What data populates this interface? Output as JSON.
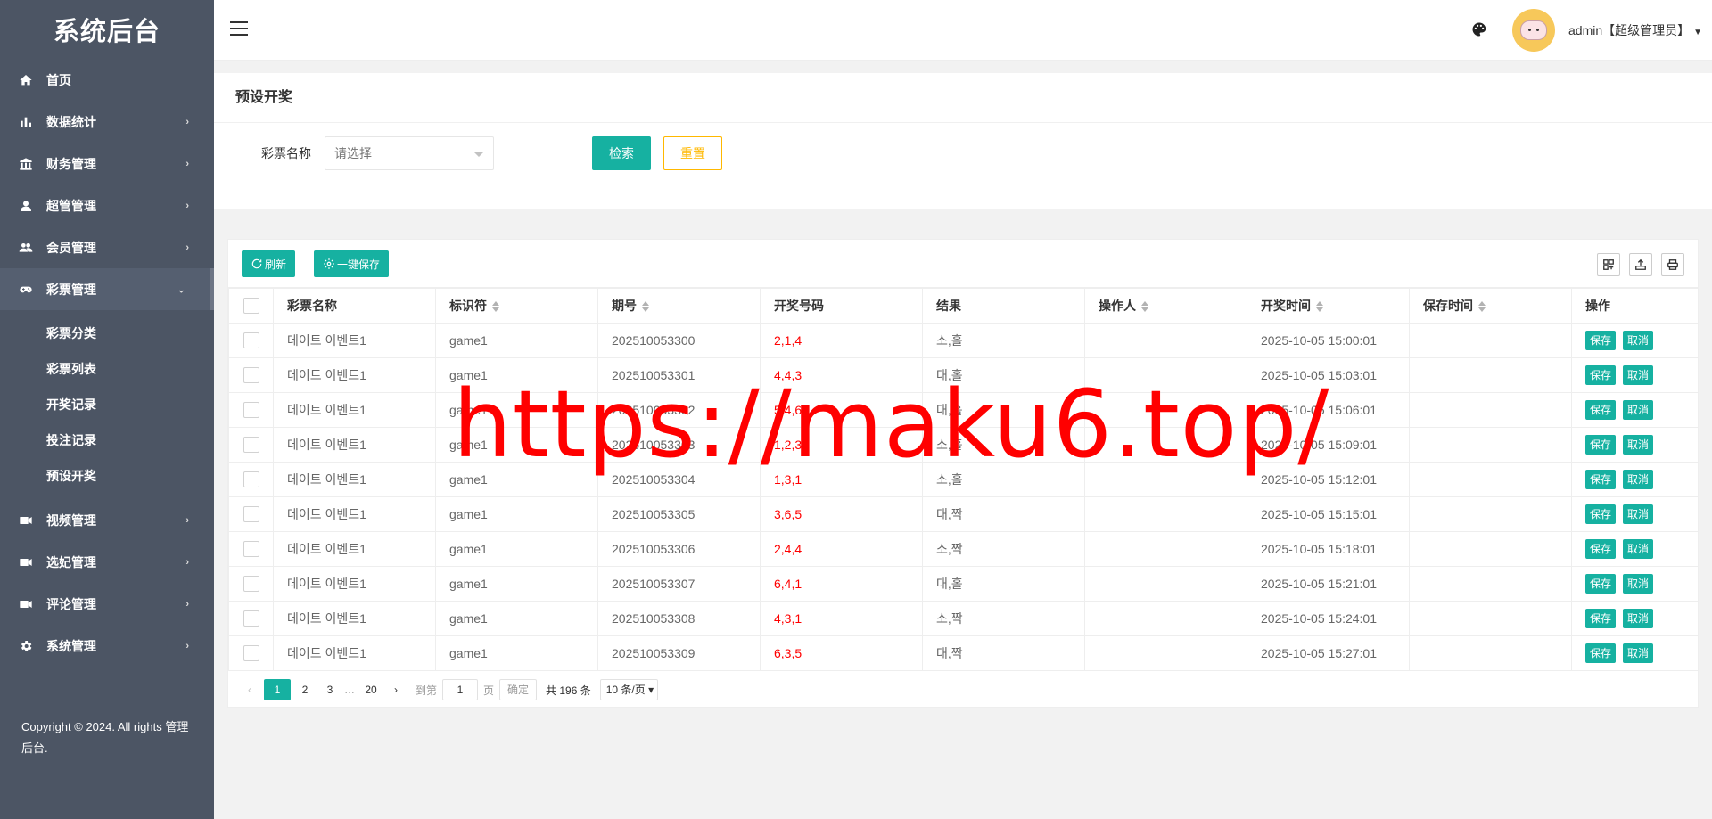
{
  "app": {
    "title": "系统后台"
  },
  "sidebar": {
    "items": [
      {
        "label": "首页",
        "icon": "home-icon",
        "has_children": false
      },
      {
        "label": "数据统计",
        "icon": "bar-chart-icon",
        "has_children": true
      },
      {
        "label": "财务管理",
        "icon": "bank-icon",
        "has_children": true
      },
      {
        "label": "超管管理",
        "icon": "user-icon",
        "has_children": true
      },
      {
        "label": "会员管理",
        "icon": "users-icon",
        "has_children": true
      },
      {
        "label": "彩票管理",
        "icon": "gamepad-icon",
        "has_children": true,
        "expanded": true,
        "children": [
          "彩票分类",
          "彩票列表",
          "开奖记录",
          "投注记录",
          "预设开奖"
        ]
      },
      {
        "label": "视频管理",
        "icon": "video-icon",
        "has_children": true
      },
      {
        "label": "选妃管理",
        "icon": "video-icon",
        "has_children": true
      },
      {
        "label": "评论管理",
        "icon": "video-icon",
        "has_children": true
      },
      {
        "label": "系统管理",
        "icon": "gear-icon",
        "has_children": true
      }
    ],
    "copyright": "Copyright © 2024. All rights 管理后台."
  },
  "header": {
    "user": "admin【超级管理员】"
  },
  "search": {
    "title": "预设开奖",
    "label": "彩票名称",
    "placeholder": "请选择",
    "search_btn": "检索",
    "reset_btn": "重置"
  },
  "toolbar": {
    "refresh": "刷新",
    "save_all": "一键保存"
  },
  "table": {
    "columns": [
      "彩票名称",
      "标识符",
      "期号",
      "开奖号码",
      "结果",
      "操作人",
      "开奖时间",
      "保存时间",
      "操作"
    ],
    "actions": {
      "save": "保存",
      "cancel": "取消"
    },
    "rows": [
      {
        "name": "데이트 이벤트1",
        "code": "game1",
        "issue": "202510053300",
        "numbers": "2,1,4",
        "result": "소,홀",
        "operator": "",
        "open_time": "2025-10-05 15:00:01",
        "save_time": ""
      },
      {
        "name": "데이트 이벤트1",
        "code": "game1",
        "issue": "202510053301",
        "numbers": "4,4,3",
        "result": "대,홀",
        "operator": "",
        "open_time": "2025-10-05 15:03:01",
        "save_time": ""
      },
      {
        "name": "데이트 이벤트1",
        "code": "game1",
        "issue": "202510053302",
        "numbers": "5,4,6",
        "result": "대,홀",
        "operator": "",
        "open_time": "2025-10-05 15:06:01",
        "save_time": ""
      },
      {
        "name": "데이트 이벤트1",
        "code": "game1",
        "issue": "202510053303",
        "numbers": "1,2,3",
        "result": "소,홀",
        "operator": "",
        "open_time": "2025-10-05 15:09:01",
        "save_time": ""
      },
      {
        "name": "데이트 이벤트1",
        "code": "game1",
        "issue": "202510053304",
        "numbers": "1,3,1",
        "result": "소,홀",
        "operator": "",
        "open_time": "2025-10-05 15:12:01",
        "save_time": ""
      },
      {
        "name": "데이트 이벤트1",
        "code": "game1",
        "issue": "202510053305",
        "numbers": "3,6,5",
        "result": "대,짝",
        "operator": "",
        "open_time": "2025-10-05 15:15:01",
        "save_time": ""
      },
      {
        "name": "데이트 이벤트1",
        "code": "game1",
        "issue": "202510053306",
        "numbers": "2,4,4",
        "result": "소,짝",
        "operator": "",
        "open_time": "2025-10-05 15:18:01",
        "save_time": ""
      },
      {
        "name": "데이트 이벤트1",
        "code": "game1",
        "issue": "202510053307",
        "numbers": "6,4,1",
        "result": "대,홀",
        "operator": "",
        "open_time": "2025-10-05 15:21:01",
        "save_time": ""
      },
      {
        "name": "데이트 이벤트1",
        "code": "game1",
        "issue": "202510053308",
        "numbers": "4,3,1",
        "result": "소,짝",
        "operator": "",
        "open_time": "2025-10-05 15:24:01",
        "save_time": ""
      },
      {
        "name": "데이트 이벤트1",
        "code": "game1",
        "issue": "202510053309",
        "numbers": "6,3,5",
        "result": "대,짝",
        "operator": "",
        "open_time": "2025-10-05 15:27:01",
        "save_time": ""
      }
    ]
  },
  "pagination": {
    "pages": [
      "1",
      "2",
      "3"
    ],
    "ellipsis": "…",
    "last": "20",
    "current": "1",
    "goto_label": "到第",
    "goto_value": "1",
    "page_unit": "页",
    "confirm": "确定",
    "total": "共 196 条",
    "limit": "10 条/页"
  },
  "watermark": "https://maku6.top/",
  "colors": {
    "sidebar": "#4c5564",
    "primary": "#16b1a1",
    "warning": "#ffb800",
    "danger": "#ff0000"
  }
}
